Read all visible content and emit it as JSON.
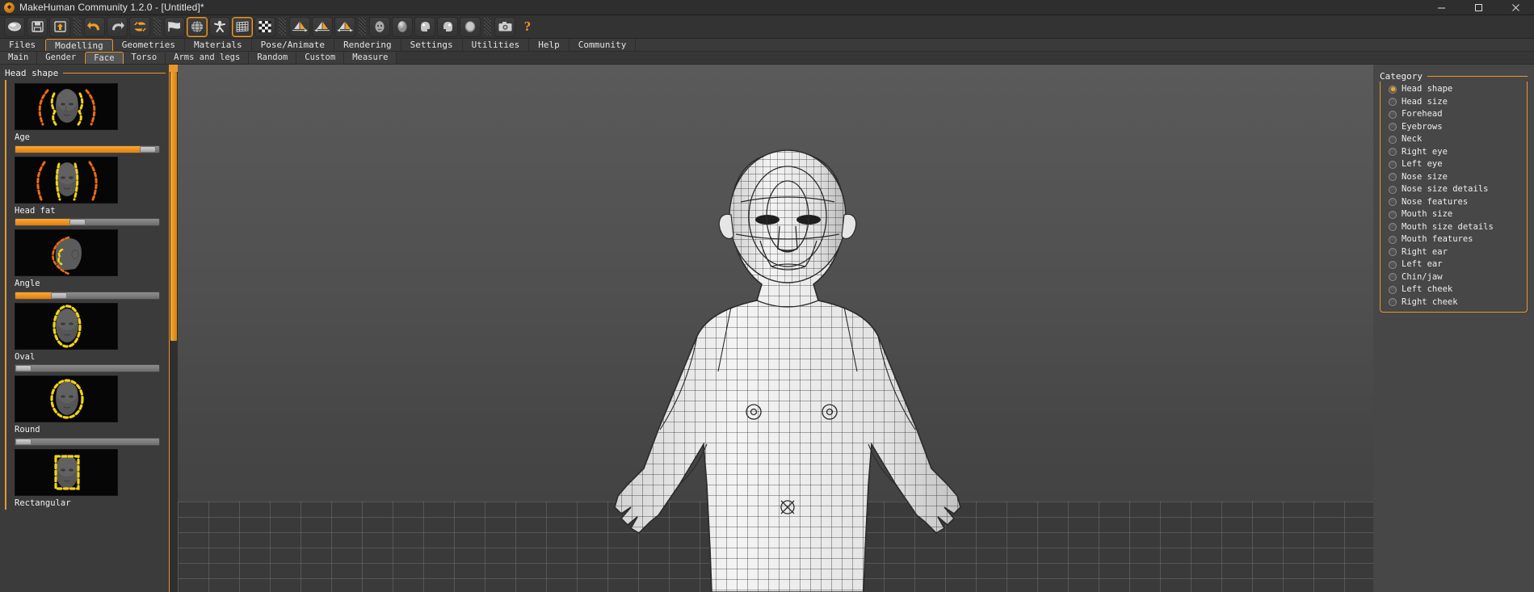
{
  "window": {
    "title": "MakeHuman Community 1.2.0 - [Untitled]*",
    "app_icon": "makehuman-logo-icon",
    "controls": [
      {
        "name": "minimize-button",
        "glyph": "minimize-icon"
      },
      {
        "name": "maximize-button",
        "glyph": "maximize-icon"
      },
      {
        "name": "close-button",
        "glyph": "close-icon"
      }
    ]
  },
  "toolbar": {
    "groups": [
      {
        "name": "file-group",
        "buttons": [
          {
            "icon": "new-mesh-icon",
            "label": "New",
            "active": false
          },
          {
            "icon": "save-floppy-icon",
            "label": "Save",
            "active": false
          },
          {
            "icon": "load-up-arrow-icon",
            "label": "Load",
            "active": false
          }
        ]
      },
      {
        "name": "history-group",
        "buttons": [
          {
            "icon": "undo-arrow-icon",
            "label": "Undo",
            "active": false
          },
          {
            "icon": "redo-arrow-icon",
            "label": "Redo",
            "active": false
          },
          {
            "icon": "reset-refresh-icon",
            "label": "Reset Mesh",
            "active": false
          }
        ]
      },
      {
        "name": "display-group",
        "buttons": [
          {
            "icon": "smooth-flag-icon",
            "label": "Smooth",
            "active": false
          },
          {
            "icon": "wireframe-globe-icon",
            "label": "Wireframe",
            "active": true
          },
          {
            "icon": "pose-figure-icon",
            "label": "Pose",
            "active": false
          },
          {
            "icon": "grid-icon",
            "label": "Grid",
            "active": true
          },
          {
            "icon": "checker-subdivision-icon",
            "label": "Subdivide",
            "active": false
          }
        ]
      },
      {
        "name": "symmetry-group",
        "buttons": [
          {
            "icon": "symmetry-right-icon",
            "label": "Symmetry Right",
            "active": false
          },
          {
            "icon": "symmetry-left-icon",
            "label": "Symmetry Left",
            "active": false
          },
          {
            "icon": "symmetry-both-icon",
            "label": "Symmetry",
            "active": false
          }
        ]
      },
      {
        "name": "camera-group",
        "buttons": [
          {
            "icon": "front-view-face-icon",
            "label": "Front view",
            "active": false
          },
          {
            "icon": "back-view-icon",
            "label": "Back view",
            "active": false
          },
          {
            "icon": "left-view-icon",
            "label": "Left view",
            "active": false
          },
          {
            "icon": "right-view-icon",
            "label": "Right view",
            "active": false
          },
          {
            "icon": "top-view-icon",
            "label": "Top view",
            "active": false
          }
        ]
      },
      {
        "name": "capture-group",
        "buttons": [
          {
            "icon": "camera-grab-screen-icon",
            "label": "Grab screen",
            "active": false
          },
          {
            "icon": "help-question-icon",
            "label": "Help",
            "active": false
          }
        ]
      }
    ]
  },
  "menu": {
    "selected": "Modelling",
    "tabs": [
      "Files",
      "Modelling",
      "Geometries",
      "Materials",
      "Pose/Animate",
      "Rendering",
      "Settings",
      "Utilities",
      "Help",
      "Community"
    ]
  },
  "subtabs": {
    "selected": "Face",
    "tabs": [
      "Main",
      "Gender",
      "Face",
      "Torso",
      "Arms and legs",
      "Random",
      "Custom",
      "Measure"
    ]
  },
  "left_panel": {
    "group_title": "Head shape",
    "sliders": [
      {
        "label": "Age",
        "value": 0.92,
        "thumb": "head-front-age-thumbnail"
      },
      {
        "label": "Head fat",
        "value": 0.4,
        "thumb": "head-front-fat-thumbnail"
      },
      {
        "label": "Angle",
        "value": 0.26,
        "thumb": "head-side-angle-thumbnail"
      },
      {
        "label": "Oval",
        "value": 0.0,
        "thumb": "head-oval-thumbnail"
      },
      {
        "label": "Round",
        "value": 0.0,
        "thumb": "head-round-thumbnail"
      },
      {
        "label": "Rectangular",
        "value": 0.0,
        "thumb": "head-rectangular-thumbnail"
      }
    ]
  },
  "right_panel": {
    "title": "Category",
    "selected": "Head shape",
    "items": [
      {
        "label": "Head shape",
        "selected": true
      },
      {
        "label": "Head size",
        "selected": false
      },
      {
        "label": "Forehead",
        "selected": false
      },
      {
        "label": "Eyebrows",
        "selected": false
      },
      {
        "label": "Neck",
        "selected": false
      },
      {
        "label": "Right eye",
        "selected": false
      },
      {
        "label": "Left eye",
        "selected": false
      },
      {
        "label": "Nose size",
        "selected": false
      },
      {
        "label": "Nose size details",
        "selected": false
      },
      {
        "label": "Nose features",
        "selected": false
      },
      {
        "label": "Mouth size",
        "selected": false
      },
      {
        "label": "Mouth size details",
        "selected": false
      },
      {
        "label": "Mouth features",
        "selected": false
      },
      {
        "label": "Right ear",
        "selected": false
      },
      {
        "label": "Left ear",
        "selected": false
      },
      {
        "label": "Chin/jaw",
        "selected": false
      },
      {
        "label": "Left cheek",
        "selected": false
      },
      {
        "label": "Right cheek",
        "selected": false
      }
    ]
  },
  "viewport": {
    "model_name": "human-baby-wireframe-mesh",
    "ground": "grid-floor"
  },
  "colors": {
    "accent": "#e8972a",
    "panel": "#3b3b3b",
    "titlebar": "#2e2e2e",
    "viewport_bg": "#4f4f4f"
  }
}
